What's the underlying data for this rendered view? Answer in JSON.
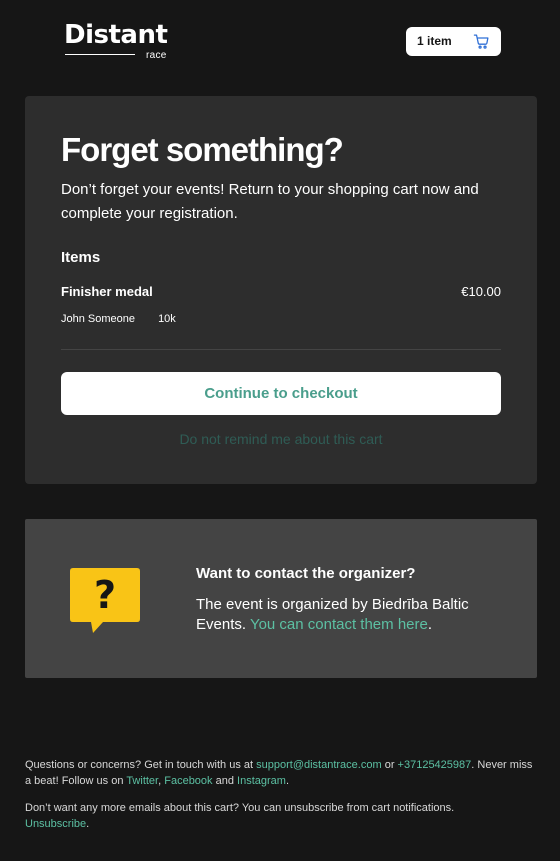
{
  "brand": {
    "name": "Distant",
    "sub": "race"
  },
  "cart": {
    "label": "1 item",
    "icon": "cart-icon"
  },
  "reminder": {
    "title": "Forget something?",
    "intro": "Don’t forget your events! Return to your shopping cart now and complete your registration.",
    "items_heading": "Items",
    "items": [
      {
        "name": "Finisher medal",
        "price": "€10.00",
        "participant": "John Someone",
        "distance": "10k"
      }
    ],
    "checkout_label": "Continue to checkout",
    "no_remind_label": "Do not remind me about this cart"
  },
  "contact": {
    "icon": "question-speech-bubble-icon",
    "title": "Want to contact the organizer?",
    "text_prefix": "The event is organized by Biedrība Baltic Events.",
    "link_label": "You can contact them here",
    "text_suffix": "."
  },
  "footer": {
    "line1_prefix": "Questions or concerns? Get in touch with us at",
    "email": "support@distantrace.com",
    "or": "or",
    "phone": "+37125425987",
    "line1_mid": ". Never miss a beat! Follow us on",
    "twitter": "Twitter",
    "comma": ",",
    "facebook": "Facebook",
    "and": "and",
    "instagram": "Instagram",
    "period": ".",
    "line2": "Don’t want any more emails about this cart? You can unsubscribe from cart notifications.",
    "unsubscribe": "Unsubscribe"
  },
  "colors": {
    "background": "#161616",
    "card": "#2d2d2d",
    "contact_card": "#444444",
    "accent": "#5cc0a3",
    "button_text": "#4a9e8c",
    "icon_yellow": "#f9c416"
  }
}
